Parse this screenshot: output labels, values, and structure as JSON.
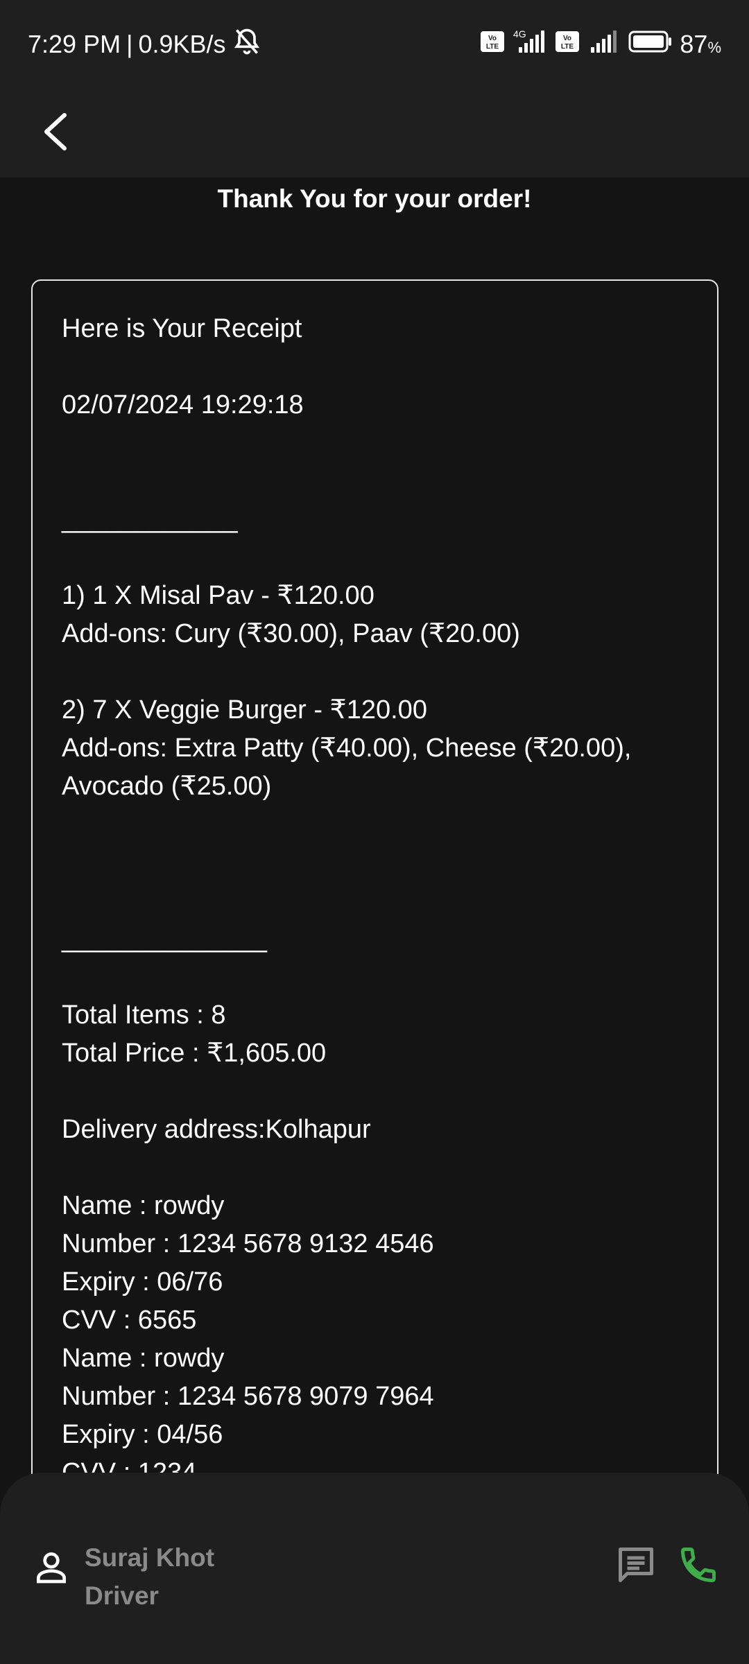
{
  "status_bar": {
    "time": "7:29 PM",
    "separator": "|",
    "net_speed": "0.9KB/s",
    "battery": "87",
    "battery_unit": "%",
    "network": "4G"
  },
  "header": {
    "title": "Thank You for your order!"
  },
  "receipt": {
    "lines": [
      "Here is Your Receipt",
      "",
      "02/07/2024 19:29:18",
      "",
      "",
      "____________",
      "",
      "1) 1 X Misal Pav - ₹120.00",
      "Add-ons: Cury (₹30.00), Paav (₹20.00)",
      "",
      "2) 7 X Veggie Burger - ₹120.00",
      "Add-ons: Extra Patty (₹40.00), Cheese (₹20.00),",
      "Avocado (₹25.00)",
      "",
      "",
      "",
      "______________",
      "",
      "Total Items : 8",
      "Total Price : ₹1,605.00",
      "",
      "Delivery address:Kolhapur",
      "",
      "Name : rowdy",
      "Number : 1234 5678 9132 4546",
      "Expiry : 06/76",
      "CVV : 6565",
      "Name : rowdy",
      "Number : 1234 5678 9079 7964",
      "Expiry : 04/56",
      "CVV : 1234"
    ]
  },
  "driver": {
    "name": "Suraj Khot",
    "role": "Driver"
  },
  "icons": {
    "back": "arrow-back-icon",
    "mute": "bell-off-icon",
    "avatar": "person-icon",
    "message": "message-icon",
    "call": "phone-icon"
  },
  "colors": {
    "background": "#141414",
    "bar": "#1f1f1f",
    "call_green": "#3fae4a",
    "muted_text": "#8a8a8a"
  }
}
